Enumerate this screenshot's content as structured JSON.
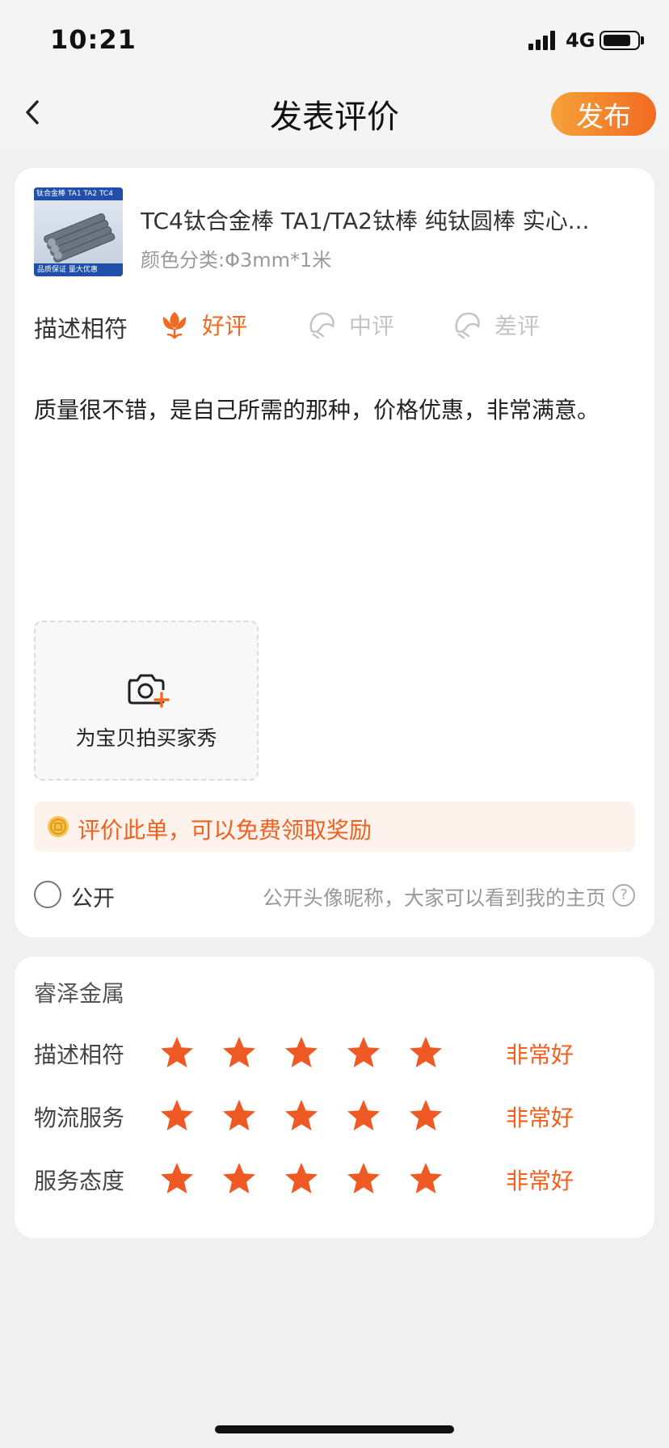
{
  "status_bar": {
    "time": "10:21",
    "network": "4G",
    "battery_level": 0.82
  },
  "nav": {
    "back_icon": "chevron-left-icon",
    "title": "发表评价",
    "publish_label": "发布"
  },
  "product": {
    "title": "TC4钛合金棒 TA1/TA2钛棒 纯钛圆棒 实心...",
    "spec": "颜色分类:Φ3mm*1米",
    "thumb_top": "钛合金棒  TA1 TA2 TC4",
    "thumb_bottom": "品质保证   量大优惠"
  },
  "rating": {
    "label": "描述相符",
    "options": [
      {
        "label": "好评",
        "icon": "flower-icon",
        "selected": true
      },
      {
        "label": "中评",
        "icon": "neutral-face-icon",
        "selected": false
      },
      {
        "label": "差评",
        "icon": "sad-face-icon",
        "selected": false
      }
    ]
  },
  "review": {
    "text": "质量很不错，是自己所需的那种，价格优惠，非常满意。"
  },
  "photo": {
    "label": "为宝贝拍买家秀",
    "icon": "camera-plus-icon"
  },
  "reward": {
    "text": "评价此单，可以免费领取奖励",
    "icon": "coin-icon"
  },
  "public": {
    "label": "公开",
    "desc": "公开头像昵称，大家可以看到我的主页",
    "help": "?",
    "checked": false
  },
  "shop": {
    "name": "睿泽金属",
    "scores": [
      {
        "label": "描述相符",
        "stars": 5,
        "text": "非常好"
      },
      {
        "label": "物流服务",
        "stars": 5,
        "text": "非常好"
      },
      {
        "label": "服务态度",
        "stars": 5,
        "text": "非常好"
      }
    ]
  },
  "colors": {
    "accent": "#f26a21",
    "accent_light": "#f6a23a",
    "reward_bg": "#fdf2ec",
    "star": "#ef5a24"
  }
}
